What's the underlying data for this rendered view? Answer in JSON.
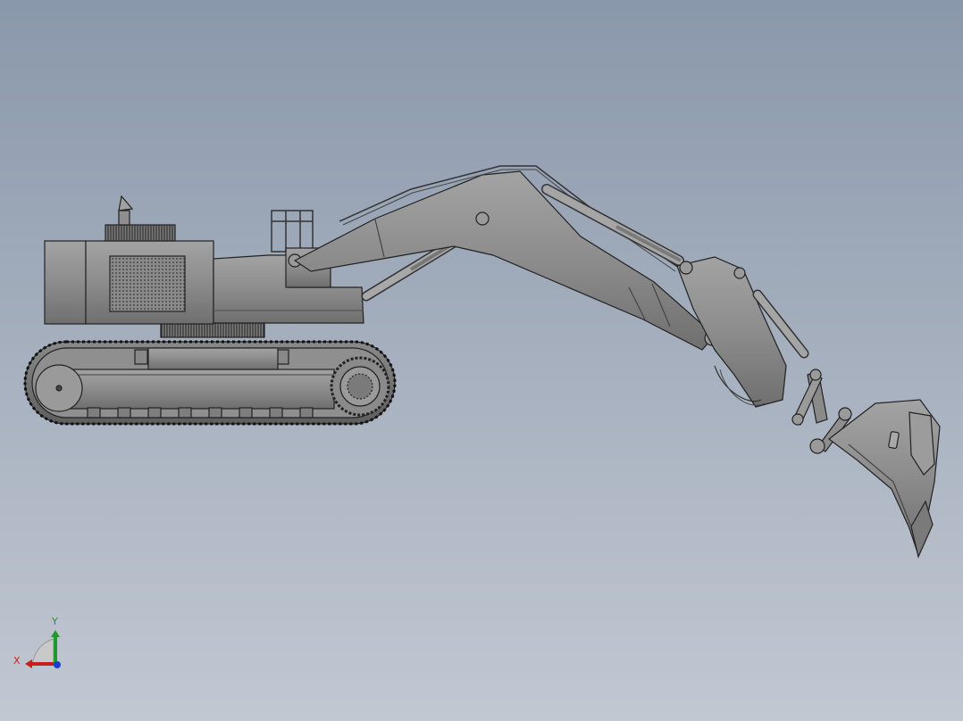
{
  "viewport": {
    "background_top": "#8a98ab",
    "background_bottom": "#c2c8d2"
  },
  "model": {
    "subject": "excavator",
    "view": "side",
    "render_style": "shaded-with-edges",
    "body_color": "#8c8c8c",
    "edge_color": "#2a2a2a"
  },
  "triad": {
    "x_label": "X",
    "y_label": "Y",
    "x_color": "#c81e1e",
    "y_color": "#1e9b2e",
    "z_color": "#1e3cc8"
  }
}
